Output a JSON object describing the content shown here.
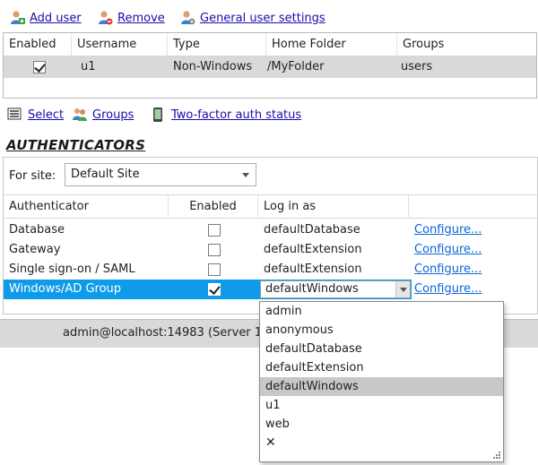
{
  "toolbar": {
    "add_user": "Add user",
    "remove": "Remove",
    "general_settings": "General user settings"
  },
  "users_grid": {
    "columns": [
      "Enabled",
      "Username",
      "Type",
      "Home Folder",
      "Groups"
    ],
    "rows": [
      {
        "enabled": true,
        "username": "u1",
        "type": "Non-Windows",
        "home_folder": "/MyFolder",
        "groups": "users"
      }
    ]
  },
  "mid_toolbar": {
    "select": "Select",
    "groups": "Groups",
    "two_factor": "Two-factor auth status"
  },
  "authenticators": {
    "heading": "AUTHENTICATORS",
    "site_label": "For site:",
    "site_value": "Default Site",
    "columns": [
      "Authenticator",
      "Enabled",
      "Log in as"
    ],
    "rows": [
      {
        "name": "Database",
        "enabled": false,
        "login_as": "defaultDatabase",
        "configure": "Configure..."
      },
      {
        "name": "Gateway",
        "enabled": false,
        "login_as": "defaultExtension",
        "configure": "Configure..."
      },
      {
        "name": "Single sign-on / SAML",
        "enabled": false,
        "login_as": "defaultExtension",
        "configure": "Configure..."
      },
      {
        "name": "Windows/AD Group",
        "enabled": true,
        "login_as": "defaultWindows",
        "configure": "Configure...",
        "selected": true
      }
    ]
  },
  "dropdown": {
    "options": [
      "admin",
      "anonymous",
      "defaultDatabase",
      "defaultExtension",
      "defaultWindows",
      "u1",
      "web"
    ],
    "highlighted": "defaultWindows",
    "clear_symbol": "✕"
  },
  "status_bar": {
    "text": "admin@localhost:14983 (Server 1)"
  },
  "colors": {
    "selection": "#0f9bea",
    "link": "#0a66d8",
    "row_highlight": "#d9d9d9"
  }
}
